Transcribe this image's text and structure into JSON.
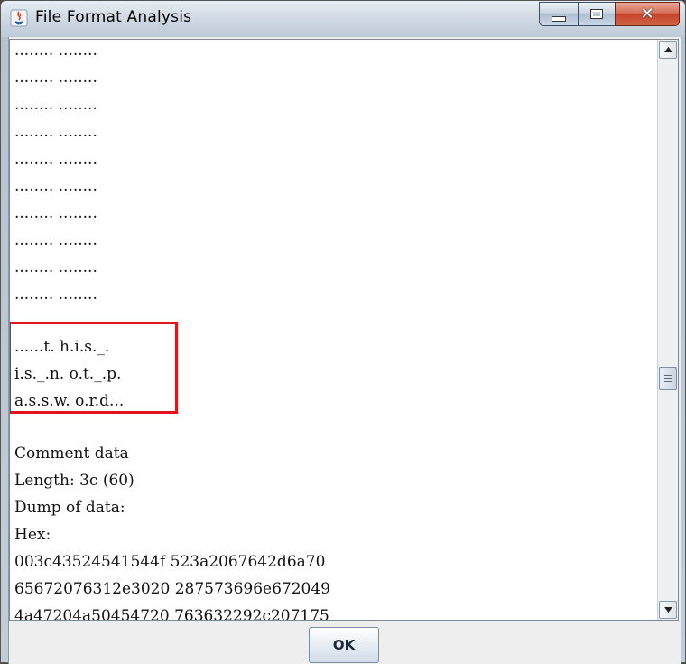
{
  "window": {
    "title": "File Format Analysis",
    "close_glyph": "✕"
  },
  "content": {
    "dot_lines": [
      "........ ........",
      "........ ........",
      "........ ........",
      "........ ........",
      "........ ........",
      "........ ........",
      "........ ........",
      "........ ........",
      "........ ........",
      "........ ........"
    ],
    "highlighted_lines": [
      "......t. h.i.s._.",
      "i.s._.n. o.t._.p.",
      "a.s.s.w. o.r.d..."
    ],
    "info_lines": [
      "Comment data",
      "Length: 3c (60)",
      "Dump of data:",
      "Hex:",
      "003c43524541544f 523a2067642d6a70",
      "65672076312e3020 287573696e672049",
      "4a47204a50454720 763632292c207175"
    ]
  },
  "buttons": {
    "ok_label": "OK"
  },
  "colors": {
    "highlight": "#e0141a"
  }
}
